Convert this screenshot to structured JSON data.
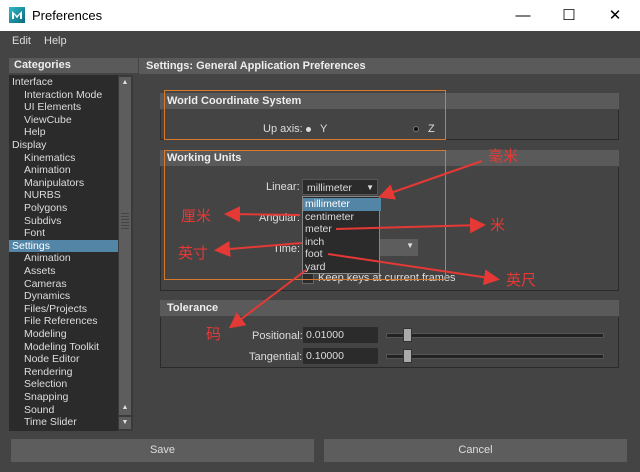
{
  "window": {
    "title": "Preferences",
    "minimize": "—",
    "maximize": "☐",
    "close": "✕"
  },
  "menu": [
    "Edit",
    "Help"
  ],
  "categories": {
    "header": "Categories",
    "items": [
      {
        "label": "Interface",
        "level": 0
      },
      {
        "label": "Interaction Mode",
        "level": 1
      },
      {
        "label": "UI Elements",
        "level": 1
      },
      {
        "label": "ViewCube",
        "level": 1
      },
      {
        "label": "Help",
        "level": 1
      },
      {
        "label": "Display",
        "level": 0
      },
      {
        "label": "Kinematics",
        "level": 1
      },
      {
        "label": "Animation",
        "level": 1
      },
      {
        "label": "Manipulators",
        "level": 1
      },
      {
        "label": "NURBS",
        "level": 1
      },
      {
        "label": "Polygons",
        "level": 1
      },
      {
        "label": "Subdivs",
        "level": 1
      },
      {
        "label": "Font",
        "level": 1
      },
      {
        "label": "Settings",
        "level": 0,
        "selected": true
      },
      {
        "label": "Animation",
        "level": 1
      },
      {
        "label": "Assets",
        "level": 1
      },
      {
        "label": "Cameras",
        "level": 1
      },
      {
        "label": "Dynamics",
        "level": 1
      },
      {
        "label": "Files/Projects",
        "level": 1
      },
      {
        "label": "File References",
        "level": 1
      },
      {
        "label": "Modeling",
        "level": 1
      },
      {
        "label": "Modeling Toolkit",
        "level": 1
      },
      {
        "label": "Node Editor",
        "level": 1
      },
      {
        "label": "Rendering",
        "level": 1
      },
      {
        "label": "Selection",
        "level": 1
      },
      {
        "label": "Snapping",
        "level": 1
      },
      {
        "label": "Sound",
        "level": 1
      },
      {
        "label": "Time Slider",
        "level": 1
      }
    ]
  },
  "settings": {
    "header": "Settings: General Application Preferences",
    "world": {
      "title": "World Coordinate System",
      "up_axis_label": "Up axis:",
      "y_label": "Y",
      "z_label": "Z",
      "selected": "Y"
    },
    "units": {
      "title": "Working Units",
      "linear_label": "Linear:",
      "linear_value": "millimeter",
      "angular_label": "Angular:",
      "time_label": "Time:",
      "options": [
        "millimeter",
        "centimeter",
        "meter",
        "inch",
        "foot",
        "yard"
      ],
      "keep_keys_label": "Keep keys at current frames"
    },
    "tolerance": {
      "title": "Tolerance",
      "positional_label": "Positional:",
      "positional_value": "0.01000",
      "positional_fraction": 0.08,
      "tangential_label": "Tangential:",
      "tangential_value": "0.10000",
      "tangential_fraction": 0.08
    }
  },
  "buttons": {
    "save": "Save",
    "cancel": "Cancel"
  },
  "annotations": {
    "millimeter": "毫米",
    "centimeter": "厘米",
    "meter": "米",
    "inch": "英寸",
    "foot": "英尺",
    "yard": "码"
  },
  "colors": {
    "orange_box": "#d77a2e",
    "annotation_red": "#e53935",
    "selection_blue": "#5285a6"
  },
  "icons": {
    "app": "maya-icon",
    "scroll_up": "triangle-up-icon",
    "scroll_down": "triangle-down-icon"
  }
}
